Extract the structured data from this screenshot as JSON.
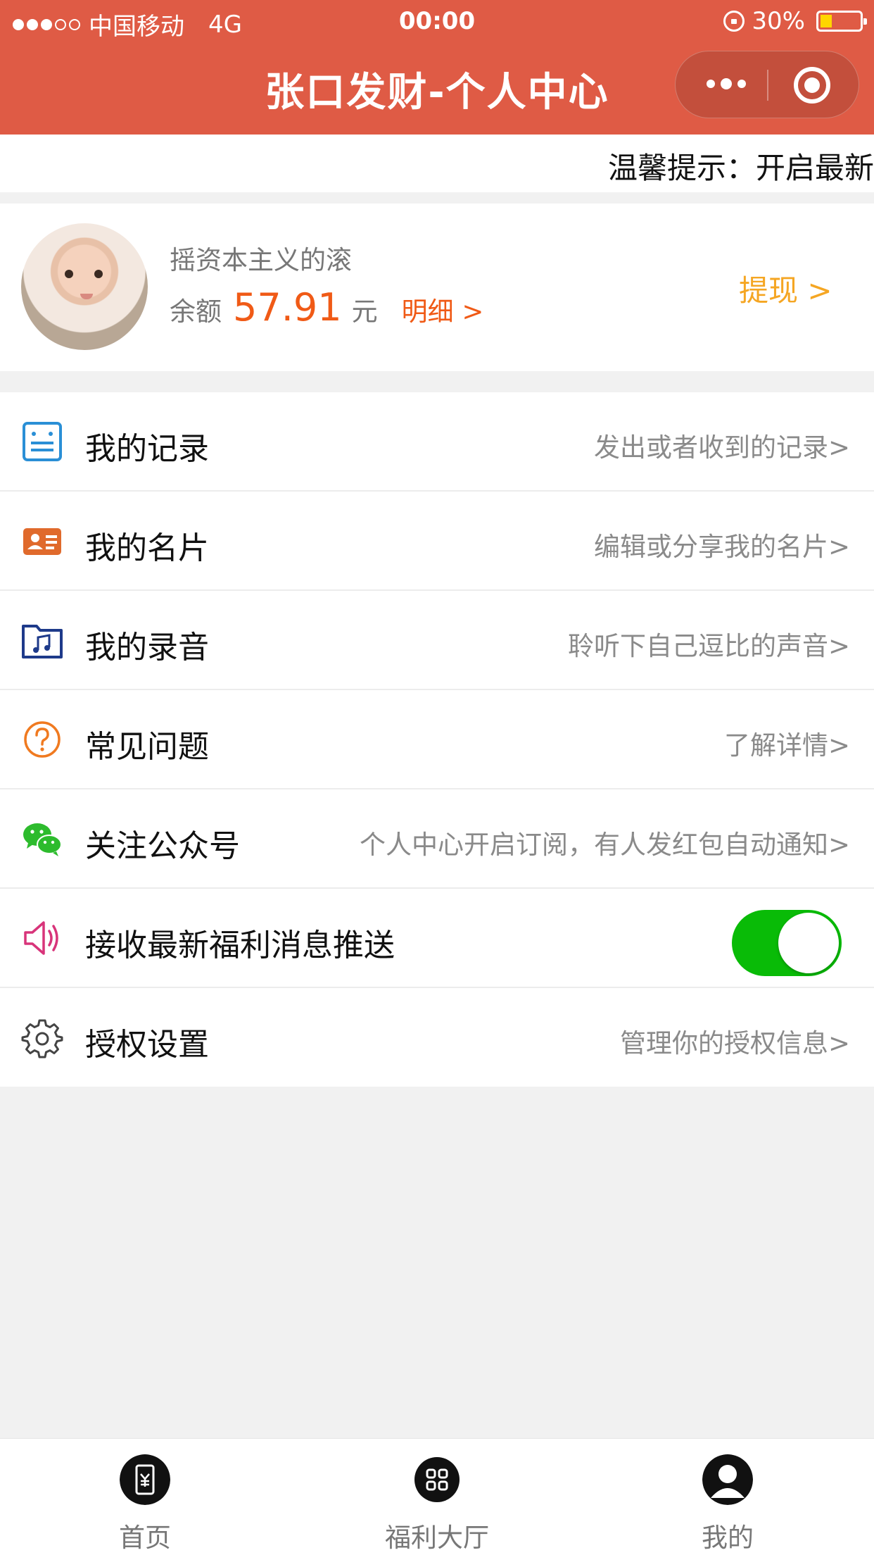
{
  "status_bar": {
    "carrier": "中国移动",
    "network": "4G",
    "time": "00:00",
    "battery": "30%",
    "battery_level": 0.3,
    "battery_color": "#ffd600"
  },
  "nav": {
    "title": "张口发财-个人中心",
    "bg_color": "#df5b45",
    "more_icon": "more-dots-icon",
    "close_icon": "target-circle-icon"
  },
  "notice": {
    "text": "温馨提示：开启最新"
  },
  "profile": {
    "nickname": "摇资本主义的滚",
    "balance_label": "余额",
    "balance_value": "57.91",
    "balance_unit": "元",
    "detail_link": "明细 >",
    "withdraw_link": "提现 >",
    "accent_color": "#f05a16",
    "withdraw_color": "#f5a623"
  },
  "menu": {
    "items": [
      {
        "label": "我的记录",
        "desc": "发出或者收到的记录>",
        "icon": "record-list-icon"
      },
      {
        "label": "我的名片",
        "desc": "编辑或分享我的名片>",
        "icon": "id-card-icon"
      },
      {
        "label": "我的录音",
        "desc": "聆听下自己逗比的声音>",
        "icon": "music-folder-icon"
      },
      {
        "label": "常见问题",
        "desc": "了解详情>",
        "icon": "question-circle-icon"
      },
      {
        "label": "关注公众号",
        "desc": "个人中心开启订阅，有人发红包自动通知>",
        "icon": "wechat-icon"
      },
      {
        "label": "接收最新福利消息推送",
        "toggle_on": true,
        "icon": "speaker-icon"
      },
      {
        "label": "授权设置",
        "desc": "管理你的授权信息>",
        "icon": "gear-icon"
      }
    ],
    "toggle_color": "#09bb07"
  },
  "tabbar": {
    "items": [
      {
        "label": "首页",
        "icon": "wallet-yen-icon",
        "active": false
      },
      {
        "label": "福利大厅",
        "icon": "grid-icon",
        "active": false
      },
      {
        "label": "我的",
        "icon": "user-icon",
        "active": true
      }
    ]
  }
}
